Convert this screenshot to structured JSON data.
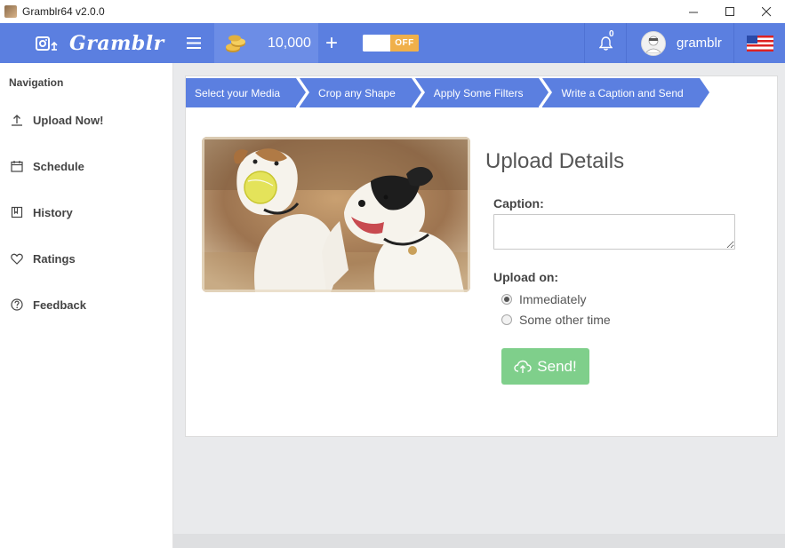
{
  "window": {
    "title": "Gramblr64 v2.0.0"
  },
  "header": {
    "brand": "Gramblr",
    "coins": "10,000",
    "plus_label": "+",
    "toggle_label": "OFF",
    "notifications_count": "0",
    "username": "gramblr"
  },
  "sidebar": {
    "heading": "Navigation",
    "items": [
      {
        "label": "Upload Now!",
        "icon": "upload-icon"
      },
      {
        "label": "Schedule",
        "icon": "calendar-icon"
      },
      {
        "label": "History",
        "icon": "bookmark-icon"
      },
      {
        "label": "Ratings",
        "icon": "heart-icon"
      },
      {
        "label": "Feedback",
        "icon": "help-icon"
      }
    ]
  },
  "steps": [
    "Select your Media",
    "Crop any Shape",
    "Apply Some Filters",
    "Write a Caption and Send"
  ],
  "form": {
    "title": "Upload Details",
    "caption_label": "Caption:",
    "caption_value": "",
    "upload_on_label": "Upload on:",
    "options": [
      {
        "label": "Immediately",
        "selected": true
      },
      {
        "label": "Some other time",
        "selected": false
      }
    ],
    "send_label": "Send!"
  },
  "colors": {
    "header": "#5b7fe0",
    "toggle_off": "#f0b04a",
    "send": "#7fcf8b"
  }
}
